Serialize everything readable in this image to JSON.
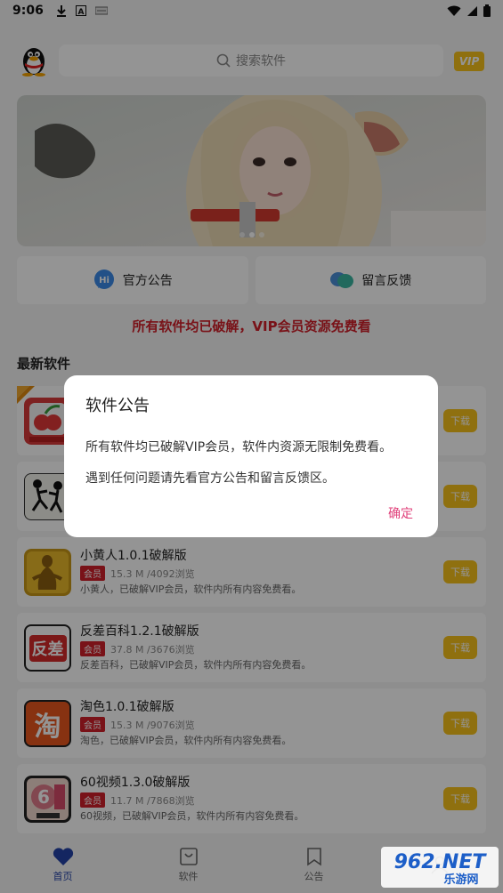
{
  "status_bar": {
    "time": "9:06",
    "icons": [
      "download-icon",
      "a-icon",
      "tag-icon"
    ],
    "right_icons": [
      "wifi-icon",
      "signal-icon",
      "battery-icon"
    ]
  },
  "header": {
    "search_placeholder": "搜索软件",
    "vip_label": "VIP"
  },
  "banner": {
    "slide_count": 3
  },
  "actions": [
    {
      "label": "官方公告",
      "icon": "hi-chat-icon"
    },
    {
      "label": "留言反馈",
      "icon": "chat-bubbles-icon"
    }
  ],
  "notice": "所有软件均已破解，VIP会员资源免费看",
  "section_title": "最新软件",
  "apps": [
    {
      "name": "",
      "badge": "",
      "size": "",
      "desc": "",
      "dl": "下载",
      "icon": "cherry-app-icon"
    },
    {
      "name": "",
      "badge": "",
      "size": "",
      "desc": "",
      "dl": "下载",
      "icon": "stickman-app-icon"
    },
    {
      "name": "小黄人1.0.1破解版",
      "badge": "会员",
      "size": "15.3 M /4092浏览",
      "desc": "小黄人，已破解VIP会员，软件内所有内容免费看。",
      "dl": "下载",
      "icon": "figure-app-icon"
    },
    {
      "name": "反差百科1.2.1破解版",
      "badge": "会员",
      "size": "37.8 M /3676浏览",
      "desc": "反差百科，已破解VIP会员，软件内所有内容免费看。",
      "dl": "下载",
      "icon": "fancha-app-icon",
      "icon_text": "反差"
    },
    {
      "name": "淘色1.0.1破解版",
      "badge": "会员",
      "size": "15.3 M /9076浏览",
      "desc": "淘色，已破解VIP会员，软件内所有内容免费看。",
      "dl": "下载",
      "icon": "tao-app-icon",
      "icon_text": "淘"
    },
    {
      "name": "60视频1.3.0破解版",
      "badge": "会员",
      "size": "11.7 M /7868浏览",
      "desc": "60视频，已破解VIP会员，软件内所有内容免费看。",
      "dl": "下载",
      "icon": "sixty-app-icon"
    }
  ],
  "bottom_nav": [
    {
      "label": "首页",
      "icon": "heart-icon",
      "active": true
    },
    {
      "label": "软件",
      "icon": "bag-icon",
      "active": false
    },
    {
      "label": "公告",
      "icon": "bookmark-icon",
      "active": false
    },
    {
      "label": "",
      "icon": "user-icon",
      "active": false
    }
  ],
  "dialog": {
    "title": "软件公告",
    "line1": "所有软件均已破解VIP会员，软件内资源无限制免费看。",
    "line2": "遇到任何问题请先看官方公告和留言反馈区。",
    "ok_label": "确定"
  },
  "watermark": {
    "brand": "962.NET",
    "sub": "乐游网"
  },
  "colors": {
    "accent_yellow": "#f7c21a",
    "notice_red": "#d0202a",
    "dialog_ok": "#e0407a",
    "nav_active": "#2342a8"
  }
}
